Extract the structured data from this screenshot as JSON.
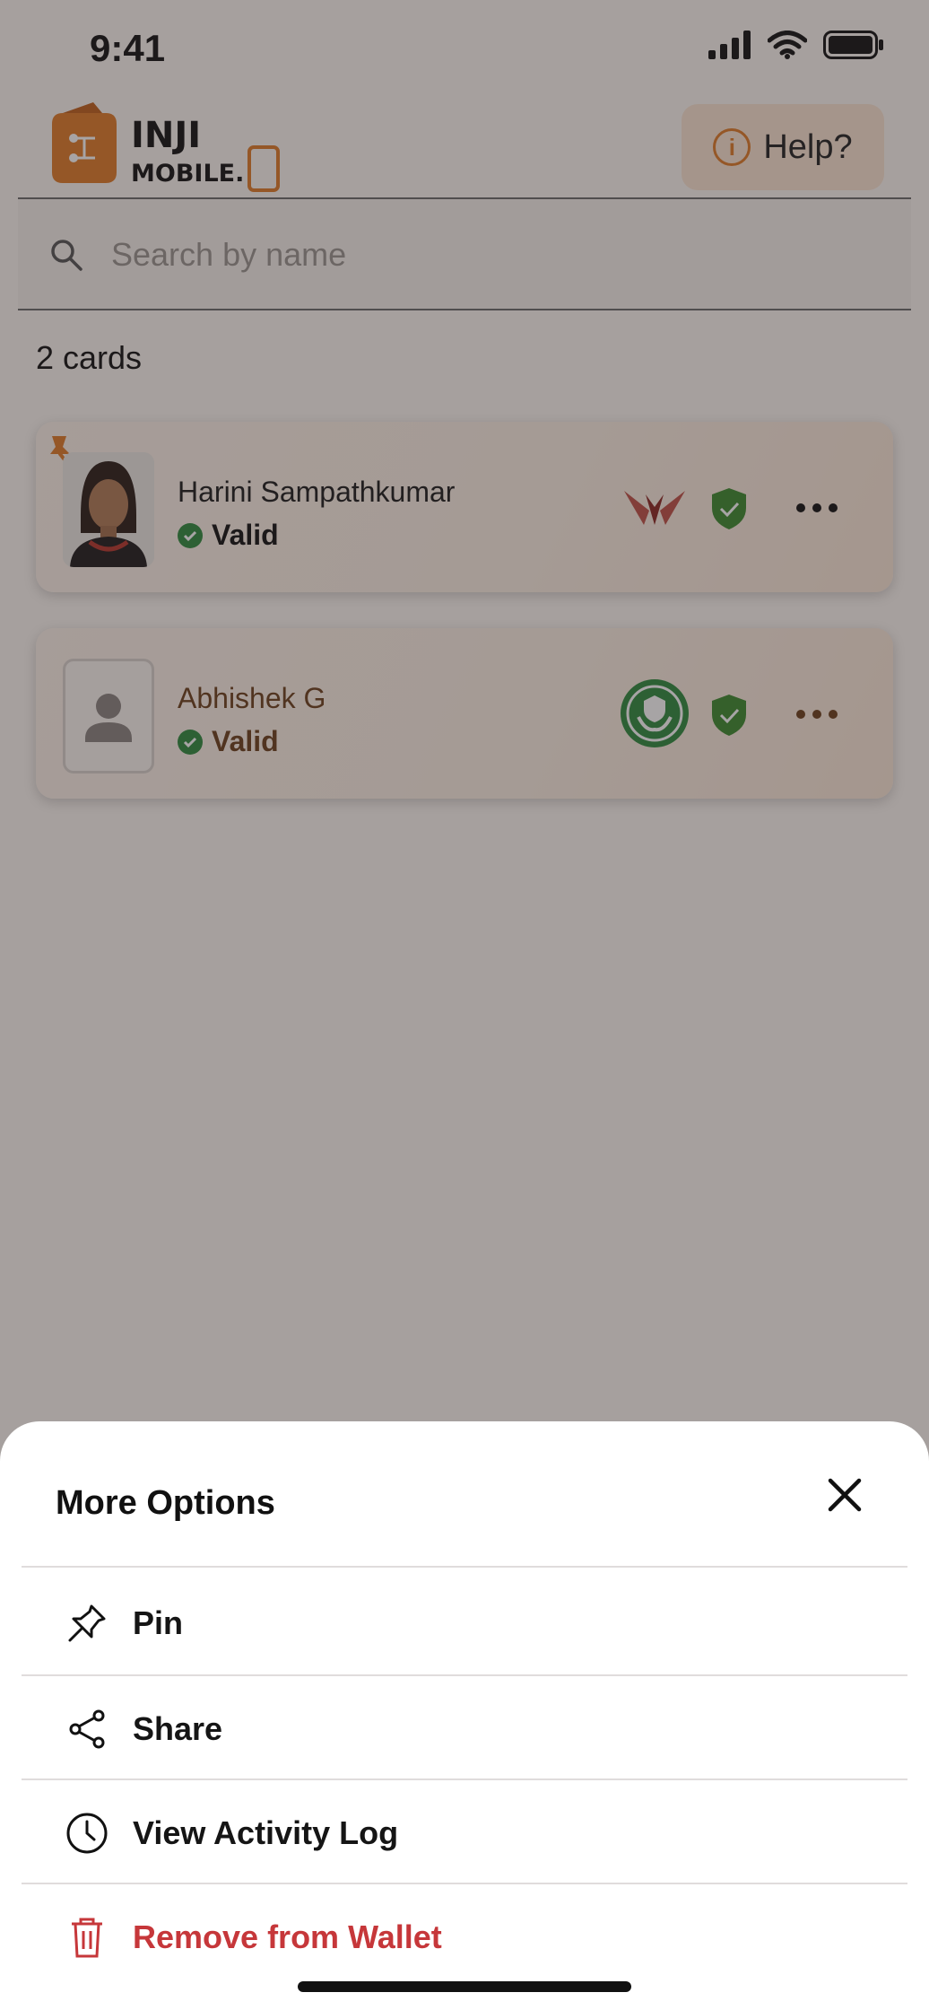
{
  "status_bar": {
    "time": "9:41"
  },
  "header": {
    "logo_top": "INJI",
    "logo_bottom": "MOBILE.",
    "help_label": "Help?"
  },
  "search": {
    "placeholder": "Search by name"
  },
  "cards_count": "2 cards",
  "cards": [
    {
      "name": "Harini Sampathkumar",
      "status": "Valid",
      "pinned": true
    },
    {
      "name": "Abhishek G",
      "status": "Valid",
      "pinned": false
    }
  ],
  "sheet": {
    "title": "More Options",
    "options": [
      {
        "label": "Pin",
        "icon": "pin-icon"
      },
      {
        "label": "Share",
        "icon": "share-icon"
      },
      {
        "label": "View Activity Log",
        "icon": "clock-icon"
      },
      {
        "label": "Remove from Wallet",
        "icon": "trash-icon"
      }
    ]
  },
  "colors": {
    "accent": "#e07b26",
    "valid": "#2e8b3d",
    "danger": "#c6373a"
  }
}
